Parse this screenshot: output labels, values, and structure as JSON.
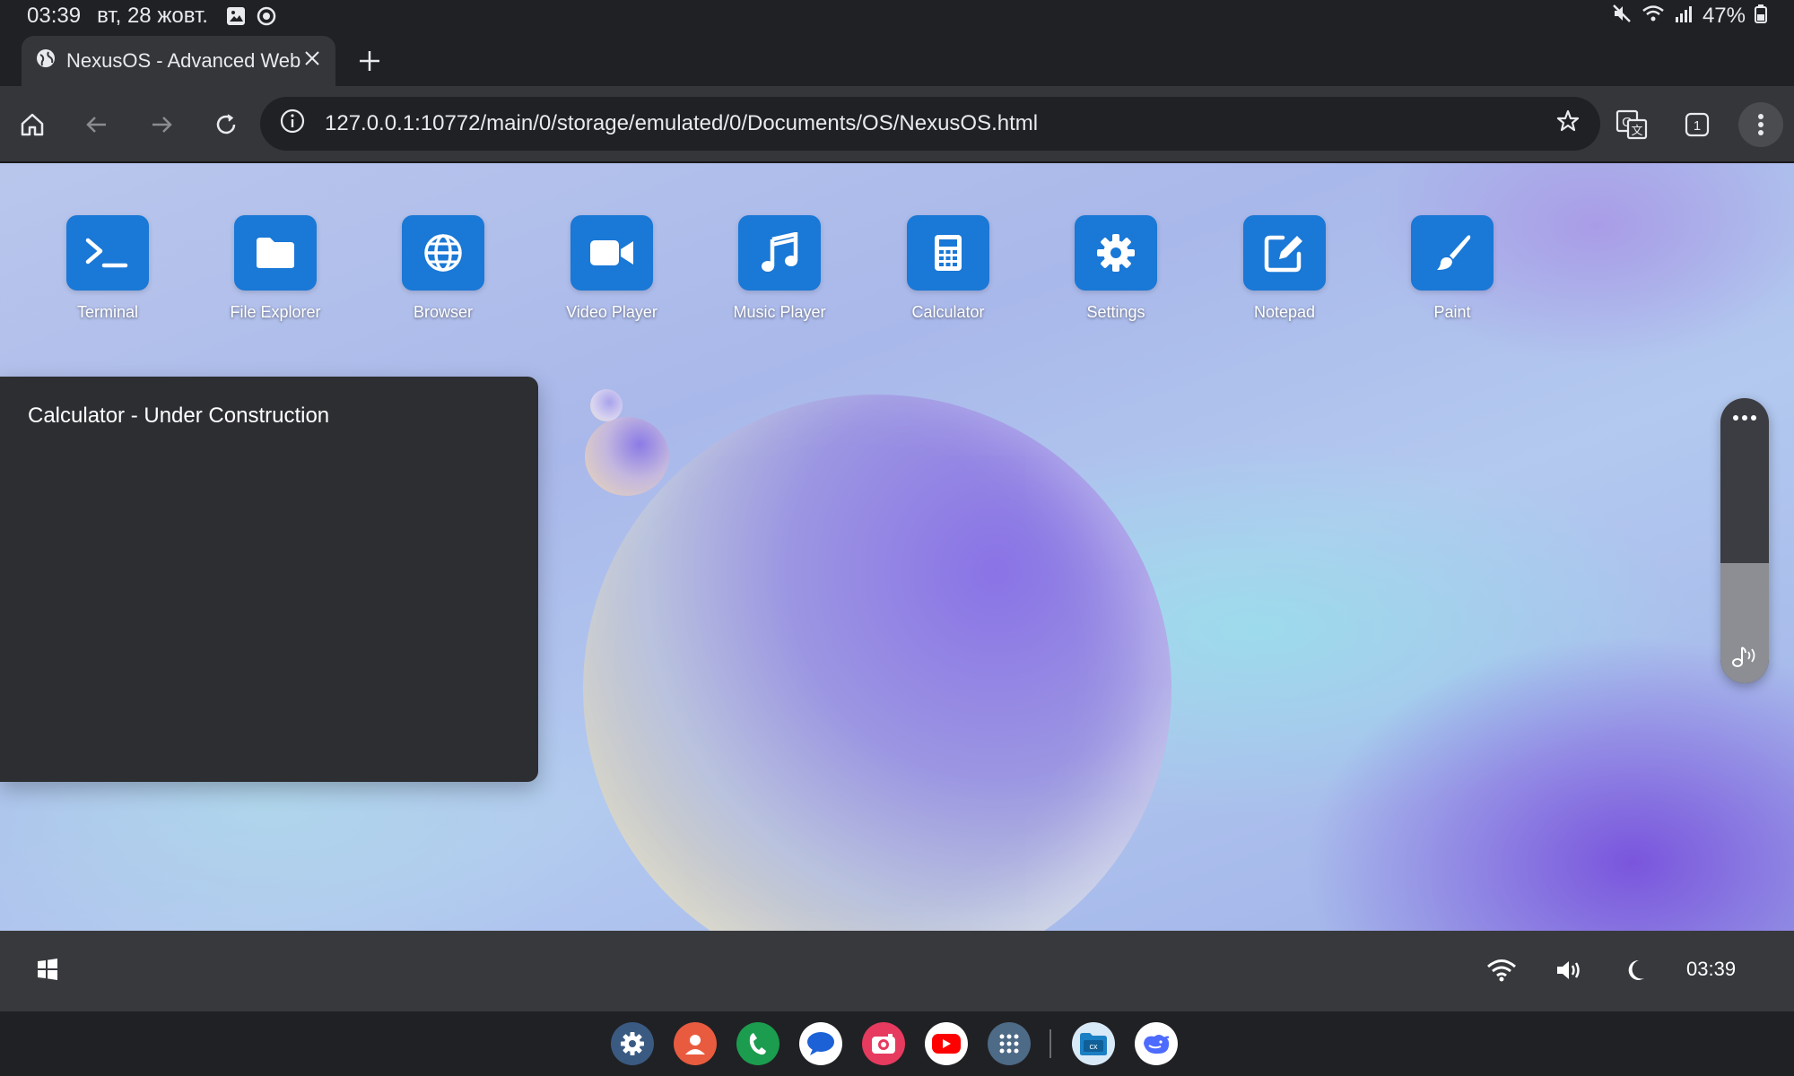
{
  "status_bar": {
    "time": "03:39",
    "date": "вт, 28 жовт.",
    "battery": "47%",
    "left_icons": [
      "gallery-icon",
      "sync-icon"
    ],
    "right_icons": [
      "mute-icon",
      "wifi-icon",
      "signal-icon",
      "battery-icon"
    ]
  },
  "browser": {
    "tab_title": "NexusOS - Advanced Web",
    "tab_icon": "globe-icon",
    "url": "127.0.0.1:10772/main/0/storage/emulated/0/Documents/OS/NexusOS.html",
    "tab_count": "1",
    "toolbar_icons": [
      "home-icon",
      "back-icon",
      "forward-icon",
      "reload-icon",
      "info-icon",
      "star-icon",
      "translate-icon",
      "tabs-icon",
      "more-vert-icon"
    ]
  },
  "desktop": {
    "apps": [
      {
        "label": "Terminal",
        "icon": "terminal-icon"
      },
      {
        "label": "File Explorer",
        "icon": "folder-icon"
      },
      {
        "label": "Browser",
        "icon": "globe-icon"
      },
      {
        "label": "Video Player",
        "icon": "video-icon"
      },
      {
        "label": "Music Player",
        "icon": "music-icon"
      },
      {
        "label": "Calculator",
        "icon": "calculator-icon"
      },
      {
        "label": "Settings",
        "icon": "gear-icon"
      },
      {
        "label": "Notepad",
        "icon": "edit-icon"
      },
      {
        "label": "Paint",
        "icon": "brush-icon"
      }
    ],
    "window": {
      "title": "Calculator - Under Construction"
    },
    "volume_panel": {
      "level": 0.42,
      "icons": [
        "more-horiz-icon",
        "music-note-icon"
      ]
    },
    "accent_color": "#1a78d6"
  },
  "taskbar": {
    "clock": "03:39",
    "icons": [
      "windows-start-icon",
      "wifi-icon",
      "volume-icon",
      "moon-icon"
    ]
  },
  "dock": {
    "apps": [
      {
        "name": "settings-app",
        "color": "#3b5a82"
      },
      {
        "name": "contacts-app",
        "color": "#e95b3f"
      },
      {
        "name": "phone-app",
        "color": "#1b9c4e"
      },
      {
        "name": "messages-app",
        "color": "#ffffff"
      },
      {
        "name": "camera-app",
        "color": "#e63a5f"
      },
      {
        "name": "youtube-app",
        "color": "#ffffff"
      },
      {
        "name": "app-drawer",
        "color": "#4d6a86"
      },
      {
        "name": "file-manager-app",
        "color": "#d8eaf7"
      },
      {
        "name": "deepseek-app",
        "color": "#ffffff"
      }
    ]
  }
}
